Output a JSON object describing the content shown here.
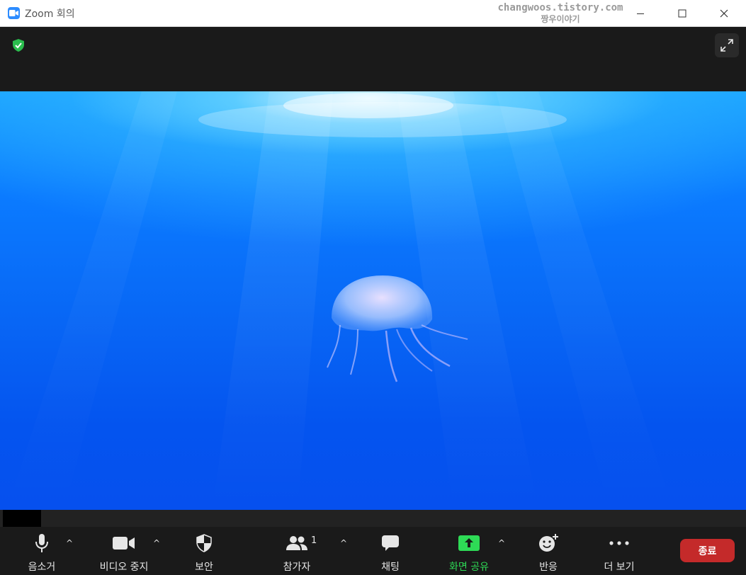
{
  "window": {
    "title": "Zoom 회의"
  },
  "watermark": {
    "line1": "changwoos.tistory.com",
    "line2": "짱우이야기"
  },
  "toolbar": {
    "mute_label": "음소거",
    "video_label": "비디오 중지",
    "security_label": "보안",
    "participants_label": "참가자",
    "participants_count": "1",
    "chat_label": "채팅",
    "share_label": "화면 공유",
    "reactions_label": "반응",
    "more_label": "더 보기",
    "end_label": "종료"
  },
  "icons": {
    "app": "zoom-camera-icon",
    "encryption": "shield-check-icon",
    "fullscreen": "expand-icon",
    "mute": "microphone-icon",
    "video": "video-camera-icon",
    "security": "shield-icon",
    "participants": "people-icon",
    "chat": "chat-bubble-icon",
    "share": "share-screen-arrow-icon",
    "reactions": "emoji-add-icon",
    "more": "ellipsis-icon"
  },
  "colors": {
    "zoom_blue": "#2d8cff",
    "share_green": "#2edb56",
    "end_red": "#c42a2a",
    "toolbar_bg": "#1a1a1a"
  }
}
